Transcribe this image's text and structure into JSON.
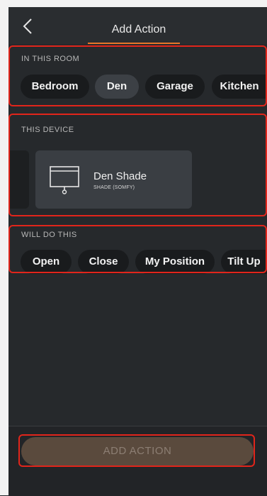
{
  "header": {
    "title": "Add Action",
    "back_icon": "chevron-left-icon"
  },
  "room": {
    "label": "IN THIS ROOM",
    "chips": [
      "Bedroom",
      "Den",
      "Garage",
      "Kitchen"
    ],
    "selected": "Den"
  },
  "device": {
    "label": "THIS DEVICE",
    "name": "Den Shade",
    "type": "SHADE (SOMFY)",
    "icon": "shade-icon"
  },
  "action": {
    "label": "WILL DO THIS",
    "chips": [
      "Open",
      "Close",
      "My Position",
      "Tilt Up"
    ]
  },
  "footer": {
    "button_label": "ADD ACTION"
  },
  "colors": {
    "accent": "#e8762a",
    "highlight": "#e1251b",
    "background": "#26292c",
    "chip": "#191b1d",
    "chip_selected": "#3c4045"
  }
}
